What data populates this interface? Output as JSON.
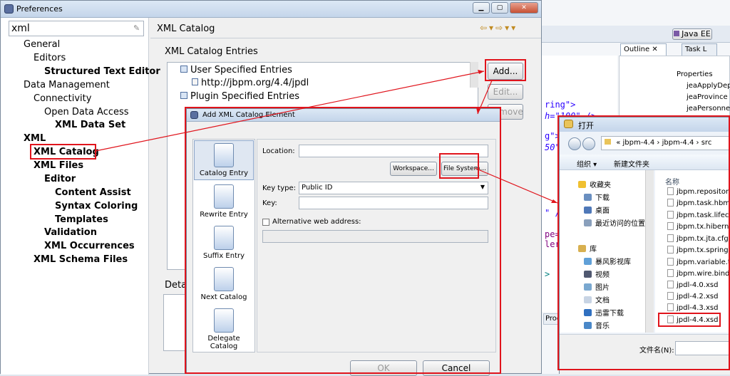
{
  "preferences": {
    "title": "Preferences",
    "filter_value": "xml",
    "tree": [
      "General",
      "Editors",
      "Structured Text Editor",
      "Data Management",
      "Connectivity",
      "Open Data Access",
      "XML Data Set",
      "XML",
      "XML Catalog",
      "XML Files",
      "Editor",
      "Content Assist",
      "Syntax Coloring",
      "Templates",
      "Validation",
      "XML Occurrences",
      "XML Schema Files"
    ],
    "page_title": "XML Catalog",
    "entries_label": "XML Catalog Entries",
    "entries": [
      "User Specified Entries",
      "http://jbpm.org/4.4/jpdl",
      "Plugin Specified Entries"
    ],
    "add_label": "Add...",
    "edit_label": "Edit...",
    "remove_label": "Remove",
    "details_label": "Detai"
  },
  "dialog": {
    "title": "Add XML Catalog Element",
    "nav": [
      "Catalog Entry",
      "Rewrite Entry",
      "Suffix Entry",
      "Next Catalog",
      "Delegate Catalog"
    ],
    "location_label": "Location:",
    "workspace_label": "Workspace...",
    "filesystem_label": "File System...",
    "keytype_label": "Key type:",
    "keytype_value": "Public ID",
    "key_label": "Key:",
    "alt_label": "Alternative web address:",
    "ok_label": "OK",
    "cancel_label": "Cancel"
  },
  "open_dialog": {
    "title": "打开",
    "path": [
      "«",
      "jbpm-4.4",
      "›",
      "jbpm-4.4",
      "›",
      "src"
    ],
    "organize_label": "组织 ▾",
    "newfolder_label": "新建文件夹",
    "nav": [
      "收藏夹",
      "下载",
      "桌面",
      "最近访问的位置",
      "库",
      "暴风影视库",
      "视频",
      "图片",
      "文档",
      "迅雷下载",
      "音乐"
    ],
    "col_name": "名称",
    "files": [
      "jbpm.repository",
      "jbpm.task.hbm.x",
      "jbpm.task.lifecyc",
      "jbpm.tx.hibernat",
      "jbpm.tx.jta.cfg.x",
      "jbpm.tx.spring.c",
      "jbpm.variable.ty",
      "jbpm.wire.bindin",
      "jpdl-4.0.xsd",
      "jpdl-4.2.xsd",
      "jpdl-4.3.xsd",
      "jpdl-4.4.xsd"
    ],
    "filename_label": "文件名(N):"
  },
  "ide": {
    "perspective": "Java EE",
    "outline_tab": "Outline",
    "tasklist_tab": "Task L",
    "outline_items": [
      "Properties",
      "jeaApplyDepa",
      "jeaProvince",
      "jeaPersonnell"
    ],
    "code_lines": [
      "ring\">",
      "h=\"100\" />",
      "g\">",
      "50\"",
      "\" />",
      "pe=",
      "ler",
      ">"
    ],
    "progress_tab": "Progr"
  }
}
